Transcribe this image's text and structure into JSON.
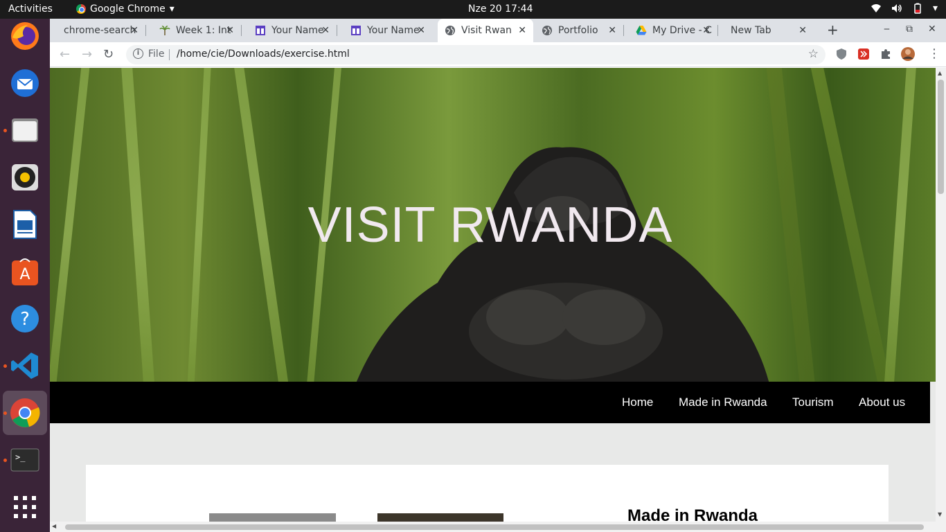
{
  "topbar": {
    "activities": "Activities",
    "app_name": "Google Chrome",
    "clock": "Nze 20  17:44"
  },
  "dock": {
    "apps": [
      "firefox-icon",
      "thunderbird-icon",
      "files-icon",
      "rhythmbox-icon",
      "libreoffice-impress-icon",
      "software-center-icon",
      "help-icon",
      "vscode-icon",
      "chrome-icon",
      "terminal-icon",
      "show-apps-icon"
    ]
  },
  "browser": {
    "tabs": [
      {
        "title": "chrome-search",
        "icon": "page-icon"
      },
      {
        "title": "Week 1: Int",
        "icon": "palm-icon"
      },
      {
        "title": "Your Name",
        "icon": "layout-icon"
      },
      {
        "title": "Your Name",
        "icon": "layout-icon"
      },
      {
        "title": "Visit Rwan",
        "icon": "globe-icon"
      },
      {
        "title": "Portfolio",
        "icon": "globe-icon"
      },
      {
        "title": "My Drive - C",
        "icon": "drive-icon"
      },
      {
        "title": "New Tab",
        "icon": ""
      }
    ],
    "new_tab_symbol": "+",
    "address": {
      "scheme": "File",
      "url": "/home/cie/Downloads/exercise.html"
    }
  },
  "page": {
    "hero_title": "VISIT RWANDA",
    "nav": [
      "Home",
      "Made in Rwanda",
      "Tourism",
      "About us"
    ],
    "section_heading": "Made in Rwanda"
  },
  "colors": {
    "navbar": "#000000",
    "hero_text": "#f1e9ef",
    "page_bg": "#e8e9e8",
    "dock_bg": "#3a2438",
    "accent": "#e95420"
  }
}
